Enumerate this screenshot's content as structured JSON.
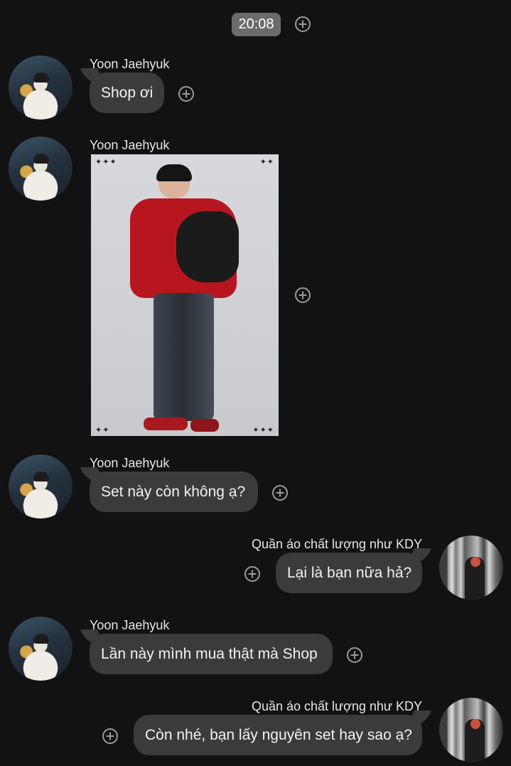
{
  "timestamp": "20:08",
  "sender_name": "Yoon Jaehyuk",
  "shop_name": "Quần áo chất lượng như KDY",
  "messages": [
    {
      "from": "customer",
      "type": "text",
      "text": "Shop ơi"
    },
    {
      "from": "customer",
      "type": "image",
      "alt": "Product photo: model in red varsity jacket and patchwork jeans"
    },
    {
      "from": "customer",
      "type": "text",
      "text": "Set này còn không ạ?"
    },
    {
      "from": "shop",
      "type": "text",
      "text": "Lại là bạn nữa hả?"
    },
    {
      "from": "customer",
      "type": "text",
      "text": "Lần này mình mua thật mà Shop"
    },
    {
      "from": "shop",
      "type": "text",
      "text": "Còn nhé, bạn lấy nguyên set hay sao ạ?"
    }
  ],
  "icons": {
    "react": "plus-circle-icon"
  },
  "colors": {
    "background": "#121212",
    "bubble": "#3b3b3b",
    "timestamp_badge": "#6b6b6b"
  }
}
